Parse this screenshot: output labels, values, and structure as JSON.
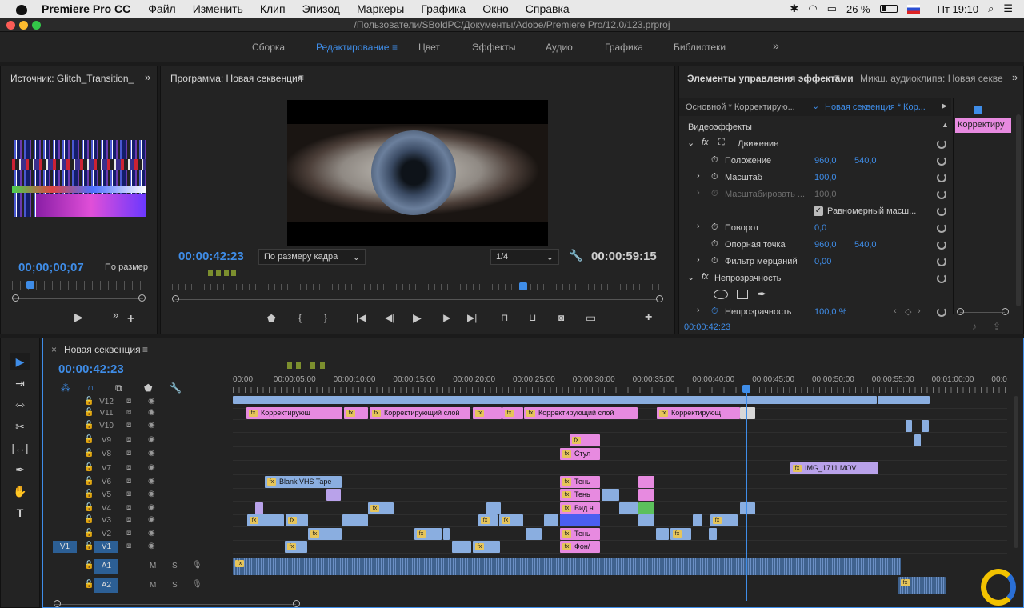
{
  "menubar": {
    "app": "Premiere Pro CC",
    "items": [
      "Файл",
      "Изменить",
      "Клип",
      "Эпизод",
      "Маркеры",
      "Графика",
      "Окно",
      "Справка"
    ],
    "battery": "26 %",
    "clock": "Пт 19:10"
  },
  "window": {
    "path": "/Пользователи/SBoldPC/Документы/Adobe/Premiere Pro/12.0/123.prproj"
  },
  "workspaces": {
    "items": [
      "Сборка",
      "Редактирование",
      "Цвет",
      "Эффекты",
      "Аудио",
      "Графика",
      "Библиотеки"
    ],
    "active": "Редактирование"
  },
  "source": {
    "tab": "Источник: Glitch_Transition_",
    "timecode": "00;00;00;07",
    "fit": "По размер"
  },
  "program": {
    "tab": "Программа: Новая секвенция",
    "timecode": "00:00:42:23",
    "fit": "По размеру кадра",
    "resolution": "1/4",
    "duration": "00:00:59:15"
  },
  "effects": {
    "tab": "Элементы управления эффектами",
    "tab2": "Микш. аудиоклипа: Новая секве",
    "master": "Основной * Корректирую...",
    "seq": "Новая секвенция * Кор...",
    "section": "Видеоэффекты",
    "clip_label": "Корректиру",
    "timecode": "00:00:42:23",
    "rows": [
      {
        "label": "Движение"
      },
      {
        "label": "Положение",
        "v1": "960,0",
        "v2": "540,0"
      },
      {
        "label": "Масштаб",
        "v1": "100,0"
      },
      {
        "label": "Масштабировать ...",
        "v1": "100,0"
      },
      {
        "label": "Равномерный масш..."
      },
      {
        "label": "Поворот",
        "v1": "0,0"
      },
      {
        "label": "Опорная точка",
        "v1": "960,0",
        "v2": "540,0"
      },
      {
        "label": "Фильтр мерцаний",
        "v1": "0,00"
      },
      {
        "label": "Непрозрачность"
      },
      {
        "label": "Непрозрачность",
        "v1": "100,0 %"
      }
    ]
  },
  "timeline": {
    "tab": "Новая секвенция",
    "timecode": "00:00:42:23",
    "ruler": [
      "00:00",
      "00:00:05:00",
      "00:00:10:00",
      "00:00:15:00",
      "00:00:20:00",
      "00:00:25:00",
      "00:00:30:00",
      "00:00:35:00",
      "00:00:40:00",
      "00:00:45:00",
      "00:00:50:00",
      "00:00:55:00",
      "00:01:00:00",
      "00:0"
    ],
    "tracks": [
      "V12",
      "V11",
      "V10",
      "V9",
      "V8",
      "V7",
      "V6",
      "V5",
      "V4",
      "V3",
      "V2",
      "V1"
    ],
    "audio": [
      "A1",
      "A2"
    ],
    "src_patch": "V1",
    "ms": [
      "M",
      "S"
    ],
    "clips": {
      "adj1": "Корректирующ",
      "adj2": "Корректирующий слой",
      "adj3": "Корректирующий слой",
      "adj4": "Корректирующ",
      "stul": "Стул",
      "img": "IMG_1711.MOV",
      "vhs": "Blank VHS Tape",
      "ten1": "Тень",
      "ten2": "Тень",
      "vid": "Вид н",
      "ten3": "Тень",
      "fon": "Фон/"
    }
  }
}
